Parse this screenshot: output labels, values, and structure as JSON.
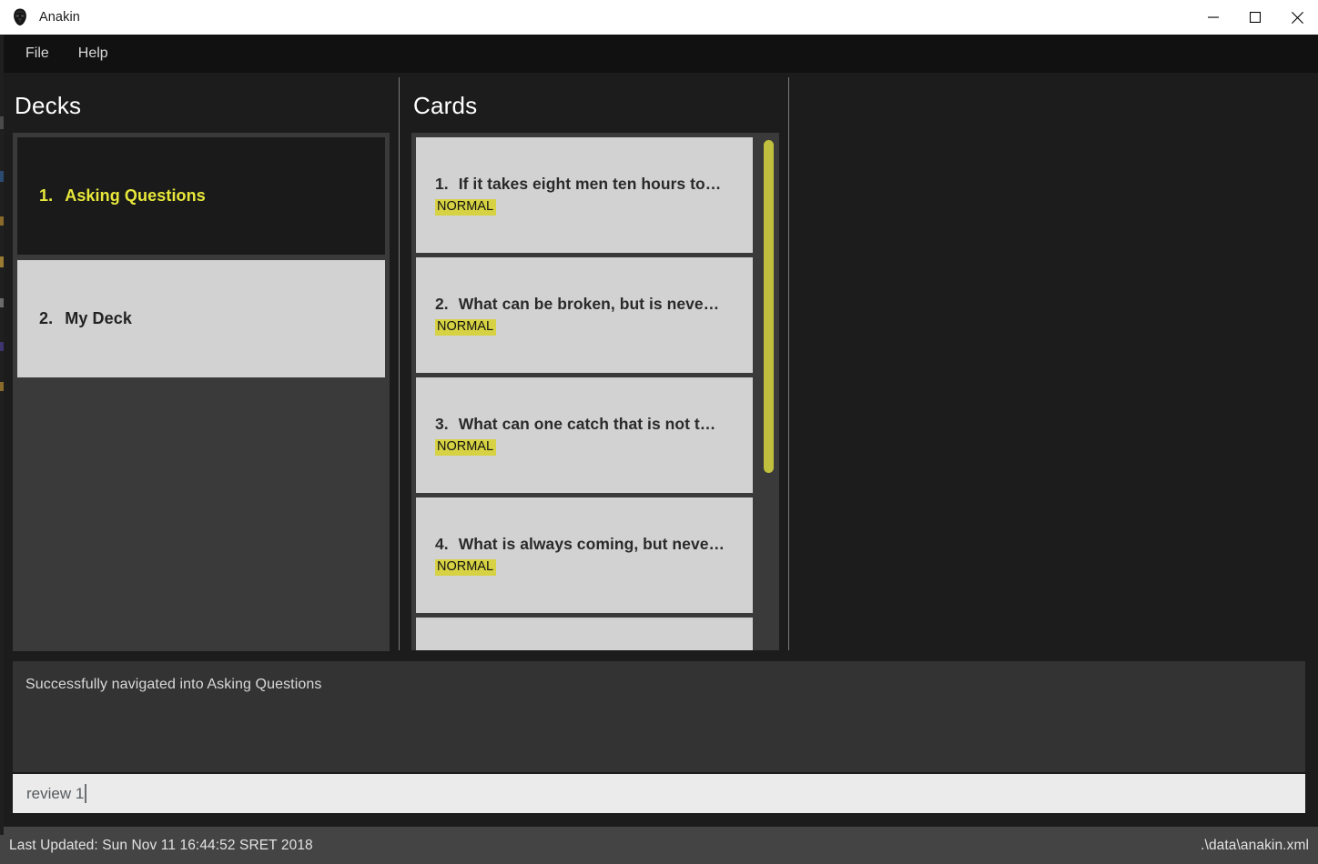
{
  "window": {
    "title": "Anakin",
    "app_icon": "darth-vader-helmet-icon",
    "controls": {
      "minimize": "minimize-icon",
      "maximize": "maximize-icon",
      "close": "close-icon"
    }
  },
  "menubar": {
    "items": [
      {
        "label": "File"
      },
      {
        "label": "Help"
      }
    ]
  },
  "decks_pane": {
    "header": "Decks",
    "items": [
      {
        "num": "1.",
        "label": "Asking Questions",
        "state": "selected"
      },
      {
        "num": "2.",
        "label": "My Deck",
        "state": "normal"
      }
    ]
  },
  "cards_pane": {
    "header": "Cards",
    "items": [
      {
        "num": "1.",
        "title": "If it takes eight men ten hours to…",
        "badge": "NORMAL"
      },
      {
        "num": "2.",
        "title": "What can be broken, but is neve…",
        "badge": "NORMAL"
      },
      {
        "num": "3.",
        "title": "What can one catch that is not t…",
        "badge": "NORMAL"
      },
      {
        "num": "4.",
        "title": "What is always coming, but neve…",
        "badge": "NORMAL"
      },
      {
        "num": "",
        "title": "",
        "badge": ""
      }
    ],
    "scrollbar": {
      "name": "cards-scrollbar",
      "thumb_color": "#c0bf3e"
    }
  },
  "console": {
    "output": "Successfully navigated into Asking Questions"
  },
  "command_input": {
    "value": "review 1",
    "placeholder": ""
  },
  "statusbar": {
    "left": "Last Updated: Sun Nov 11 16:44:52 SRET 2018",
    "right": ".\\data\\anakin.xml"
  },
  "colors": {
    "accent_yellow": "#e8e83b",
    "badge_yellow": "#d6d243",
    "scrollbar_yellow": "#c0bf3e",
    "panel_dark": "#1c1c1c",
    "list_bg": "#3a3a3a",
    "card_bg": "#d2d2d2",
    "console_bg": "#333333",
    "input_bg": "#ebebeb",
    "statusbar_bg": "#444444"
  }
}
